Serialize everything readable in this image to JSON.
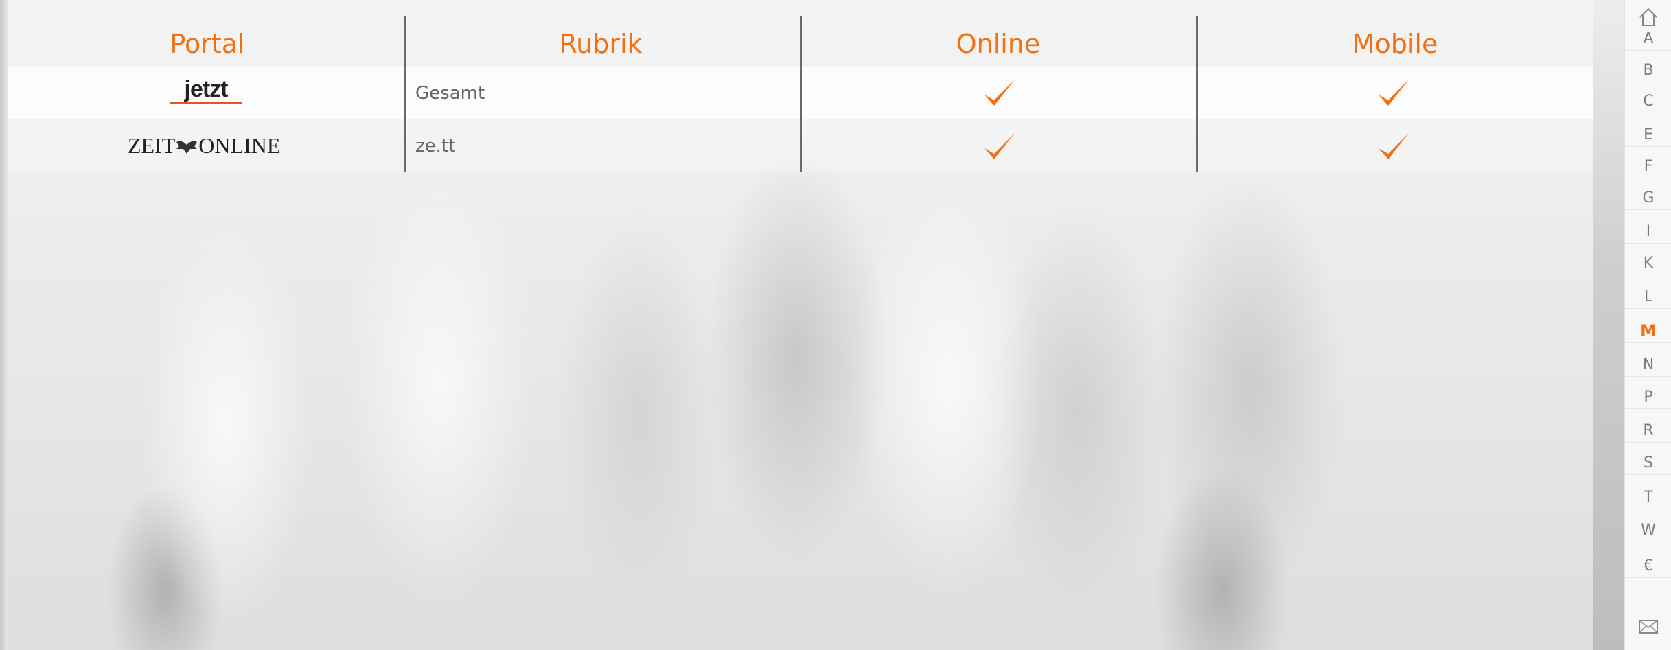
{
  "table": {
    "headers": {
      "portal": "Portal",
      "rubrik": "Rubrik",
      "online": "Online",
      "mobile": "Mobile"
    },
    "rows": [
      {
        "portal_logo_text": "jetzt",
        "rubrik": "Gesamt",
        "online": true,
        "mobile": true
      },
      {
        "portal_logo_text": "ZEIT ONLINE",
        "portal_logo_left": "ZEIT",
        "portal_logo_right": "ONLINE",
        "rubrik": "ze.tt",
        "online": true,
        "mobile": true
      }
    ]
  },
  "nav": {
    "home_icon": "home-icon",
    "letters": [
      "A",
      "B",
      "C",
      "E",
      "F",
      "G",
      "I",
      "K",
      "L",
      "M",
      "N",
      "P",
      "R",
      "S",
      "T",
      "W",
      "€"
    ],
    "active": "M",
    "mail_icon": "mail-icon"
  },
  "colors": {
    "accent": "#f07012",
    "divider": "#6a6a6a",
    "nav_text": "#7d7d7d"
  }
}
